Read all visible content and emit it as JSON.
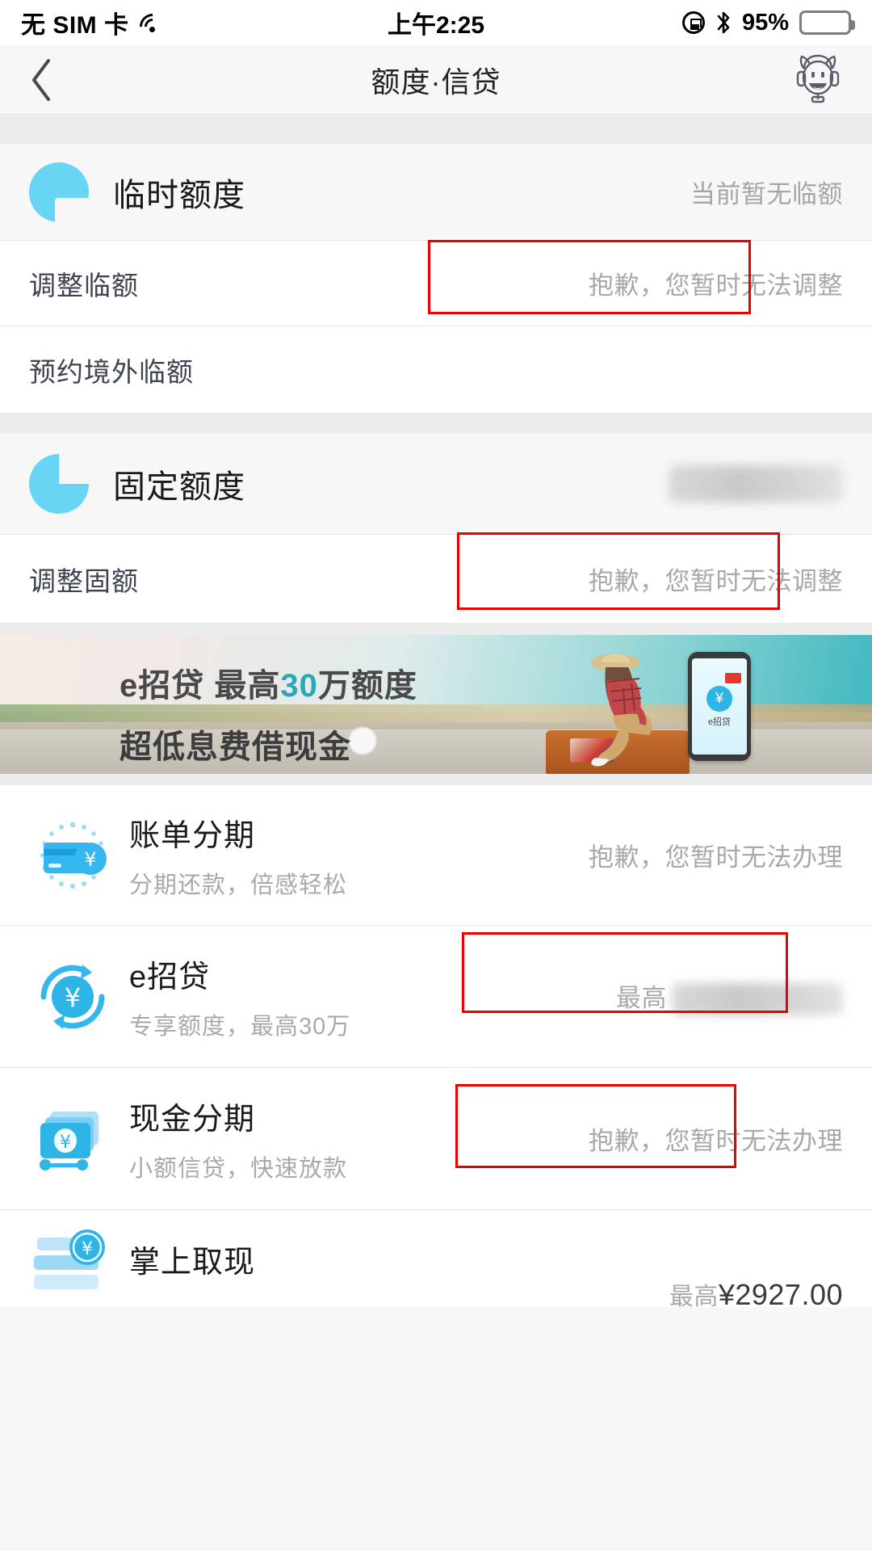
{
  "status_bar": {
    "carrier": "无 SIM 卡",
    "wifi_icon": "wifi-icon",
    "time": "上午2:25",
    "rotation_lock_icon": "rotation-lock-icon",
    "bluetooth_icon": "bluetooth-icon",
    "battery_percent": "95%",
    "battery_icon": "battery-icon"
  },
  "nav": {
    "back_icon": "chevron-left-icon",
    "title": "额度·信贷",
    "assistant_icon": "mascot-avatar-icon"
  },
  "temporary_limit": {
    "icon": "pie-chart-icon",
    "title": "临时额度",
    "value": "当前暂无临额",
    "rows": [
      {
        "label": "调整临额",
        "value": "抱歉，您暂时无法调整",
        "highlighted": true
      },
      {
        "label": "预约境外临额",
        "value": "",
        "highlighted": false
      }
    ]
  },
  "fixed_limit": {
    "icon": "pie-chart-icon",
    "title": "固定额度",
    "value": "",
    "value_redacted": true,
    "rows": [
      {
        "label": "调整固额",
        "value": "抱歉，您暂时无法调整",
        "highlighted": true
      }
    ]
  },
  "banner": {
    "line1_prefix": "e招贷  最高",
    "line1_highlight": "30",
    "line1_suffix": "万额度",
    "line2": "超低息费借现金",
    "phone_label": "e招贷",
    "phone_symbol": "¥"
  },
  "products": [
    {
      "icon": "credit-card-installment-icon",
      "title": "账单分期",
      "subtitle": "分期还款，倍感轻松",
      "value": "抱歉，您暂时无法办理",
      "value_redacted": false,
      "highlighted": false
    },
    {
      "icon": "loan-refresh-icon",
      "title": "e招贷",
      "subtitle": "专享额度，最高30万",
      "value_prefix": "最高",
      "value": "",
      "value_redacted": true,
      "highlighted": true
    },
    {
      "icon": "cash-installment-icon",
      "title": "现金分期",
      "subtitle": "小额信贷，快速放款",
      "value": "抱歉，您暂时无法办理",
      "value_redacted": false,
      "highlighted": true
    },
    {
      "icon": "mobile-cash-withdraw-icon",
      "title": "掌上取现",
      "subtitle": "",
      "value_prefix": "最高",
      "value": "¥2927.00",
      "value_redacted": false,
      "highlighted": false
    }
  ],
  "colors": {
    "accent_blue": "#2fb4e8",
    "icon_blue": "#68d5f5",
    "annotation_red": "#ee0000",
    "muted_text": "#a8a8a8",
    "page_bg": "#ececec"
  }
}
